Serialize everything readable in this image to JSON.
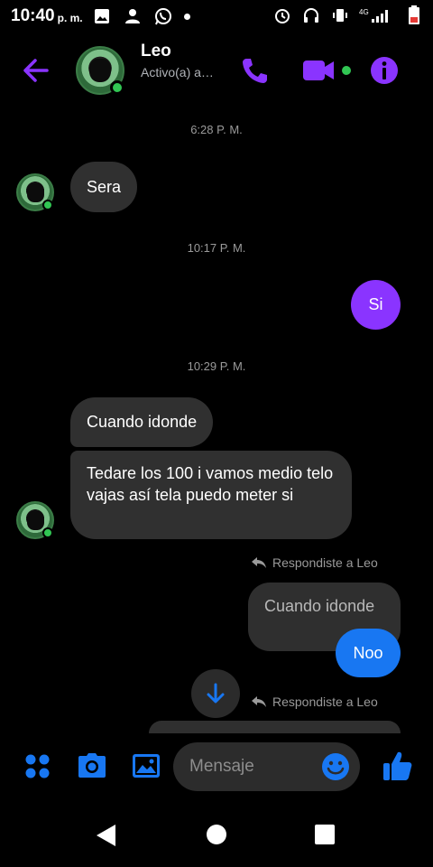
{
  "status_bar": {
    "time": "10:40",
    "ampm": "p. m.",
    "network": "4G"
  },
  "header": {
    "contact_name": "Leo",
    "contact_status": "Activo(a) a…",
    "accent_color": "#8a34ff",
    "icons": [
      "back-arrow-icon",
      "phone-icon",
      "video-camera-icon",
      "info-icon"
    ]
  },
  "messages": {
    "timestamps": [
      "6:28 P. M.",
      "10:17 P. M.",
      "10:29 P. M."
    ],
    "items": [
      {
        "from": "Leo",
        "text": "Sera"
      },
      {
        "from": "me",
        "text": "Si"
      },
      {
        "from": "Leo",
        "text": "Cuando idonde"
      },
      {
        "from": "Leo",
        "text": "Tedare los 100 i vamos medio telo vajas así tela puedo meter si"
      },
      {
        "from": "me",
        "text": "Noo",
        "reply_to": "Cuando idonde"
      }
    ],
    "reply_label": "Respondiste a Leo",
    "reply_quote": "Cuando idonde"
  },
  "composer": {
    "placeholder": "Mensaje",
    "icons": [
      "menu-dots-icon",
      "camera-icon",
      "gallery-icon",
      "emoji-icon",
      "like-icon"
    ]
  }
}
